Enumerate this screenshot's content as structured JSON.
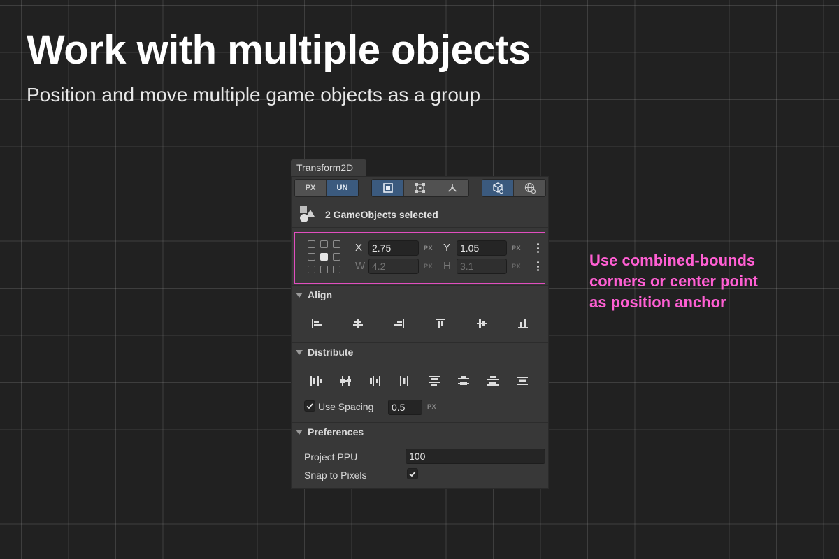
{
  "headline": "Work with multiple objects",
  "subheadline": "Position and move multiple game objects as a group",
  "panel": {
    "tab_title": "Transform2D",
    "unit_toggle": {
      "px_label": "PX",
      "un_label": "UN",
      "selected": "UN"
    },
    "mode_toggle": {
      "selected": "bounds",
      "options": [
        "square-icon",
        "rect-transform-icon",
        "pivot-icon"
      ]
    },
    "space_toggle": {
      "selected": "local",
      "options": [
        "local-space-cube-icon",
        "global-space-globe-icon"
      ]
    },
    "selection_text": "2 GameObjects selected",
    "position": {
      "x_label": "X",
      "x_value": "2.75",
      "x_unit": "PX",
      "y_label": "Y",
      "y_value": "1.05",
      "y_unit": "PX",
      "w_label": "W",
      "w_value": "4.2",
      "w_unit": "PX",
      "h_label": "H",
      "h_value": "3.1",
      "h_unit": "PX",
      "anchor_selected": "center"
    },
    "align": {
      "title": "Align",
      "buttons": [
        "align-left-icon",
        "align-center-horizontal-icon",
        "align-right-icon",
        "align-top-icon",
        "align-middle-vertical-icon",
        "align-bottom-icon"
      ]
    },
    "distribute": {
      "title": "Distribute",
      "buttons": [
        "distribute-left-icon",
        "distribute-center-horizontal-icon",
        "distribute-right-icon",
        "distribute-horizontal-spacing-icon",
        "distribute-top-icon",
        "distribute-middle-vertical-icon",
        "distribute-bottom-icon",
        "distribute-vertical-spacing-icon"
      ],
      "use_spacing_label": "Use Spacing",
      "use_spacing_checked": true,
      "spacing_value": "0.5",
      "spacing_unit": "PX"
    },
    "preferences": {
      "title": "Preferences",
      "project_ppu_label": "Project PPU",
      "project_ppu_value": "100",
      "snap_label": "Snap to Pixels",
      "snap_checked": true
    }
  },
  "callout": {
    "lines": [
      "Use combined-bounds",
      "corners or center point",
      "as position anchor"
    ],
    "color": "#ff5fd3"
  },
  "colors": {
    "accent_blue": "#3b5a7e",
    "highlight_pink": "#e14ebf",
    "panel_bg": "#383838",
    "canvas_bg": "#212121"
  }
}
